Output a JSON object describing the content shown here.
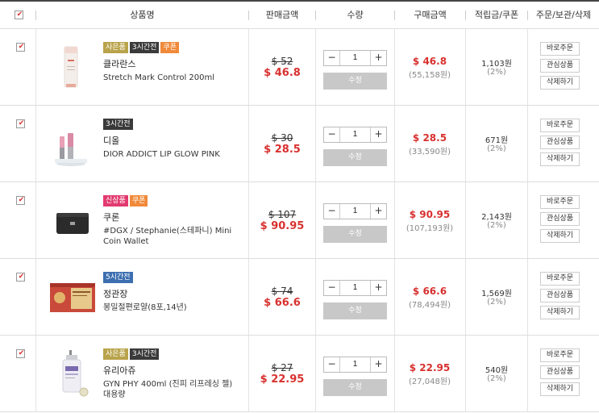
{
  "header": {
    "product": "상품명",
    "price": "판매금액",
    "quantity": "수량",
    "purchase": "구매금액",
    "points": "적립금/쿠폰",
    "actions": "주문/보관/삭제"
  },
  "labels": {
    "change_qty": "수정",
    "order_now": "바로주문",
    "wishlist": "관심상품",
    "delete": "삭제하기"
  },
  "items": [
    {
      "brand": "클라란스",
      "name": "Stretch Mark Control 200ml",
      "badges": [
        "사은품",
        "3시간전",
        "쿠폰"
      ],
      "orig_price": "$ 52",
      "sale_price": "$ 46.8",
      "qty": "1",
      "total": "$ 46.8",
      "total_krw": "(55,158원)",
      "points": "1,103원",
      "points_pct": "(2%)",
      "checked": true
    },
    {
      "brand": "디올",
      "name": "DIOR ADDICT LIP GLOW PINK",
      "badges": [
        "3시간전"
      ],
      "orig_price": "$ 30",
      "sale_price": "$ 28.5",
      "qty": "1",
      "total": "$ 28.5",
      "total_krw": "(33,590원)",
      "points": "671원",
      "points_pct": "(2%)",
      "checked": true
    },
    {
      "brand": "쿠론",
      "name": "#DGX / Stephanie(스테파니) Mini Coin Wallet",
      "badges": [
        "신상품",
        "쿠폰"
      ],
      "orig_price": "$ 107",
      "sale_price": "$ 90.95",
      "qty": "1",
      "total": "$ 90.95",
      "total_krw": "(107,193원)",
      "points": "2,143원",
      "points_pct": "(2%)",
      "checked": true
    },
    {
      "brand": "정관장",
      "name": "봉밀절편로얄(8포,14년)",
      "badges": [
        "5시간전"
      ],
      "orig_price": "$ 74",
      "sale_price": "$ 66.6",
      "qty": "1",
      "total": "$ 66.6",
      "total_krw": "(78,494원)",
      "points": "1,569원",
      "points_pct": "(2%)",
      "checked": true
    },
    {
      "brand": "유리아쥬",
      "name": "GYN PHY 400ml (진피 리프레싱 젤) 대용량",
      "badges": [
        "사은품",
        "3시간전"
      ],
      "orig_price": "$ 27",
      "sale_price": "$ 22.95",
      "qty": "1",
      "total": "$ 22.95",
      "total_krw": "(27,048원)",
      "points": "540원",
      "points_pct": "(2%)",
      "checked": true
    }
  ],
  "badge_colors": {
    "사은품": "#b9a34b",
    "3시간전": "#3a3a3a",
    "5시간전": "#3d6fb0",
    "쿠폰": "#f08a3a",
    "신상품": "#e23a6f"
  },
  "accent_color": "#d8312f"
}
